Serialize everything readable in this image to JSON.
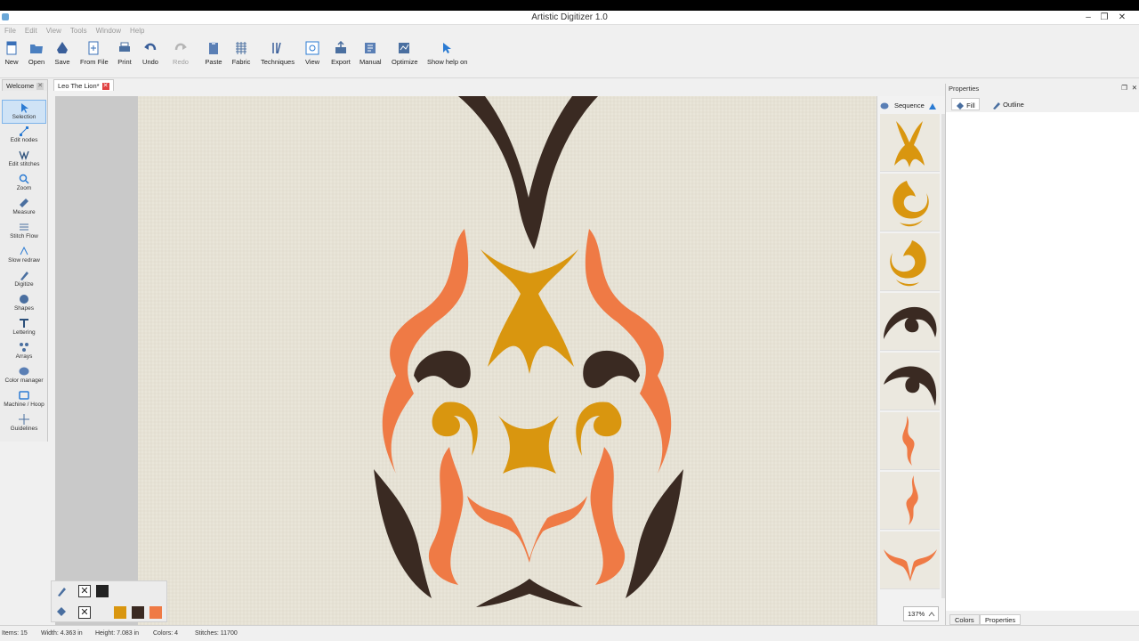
{
  "window": {
    "title": "Artistic Digitizer 1.0",
    "controls": [
      "–",
      "❐",
      "✕"
    ]
  },
  "menu": [
    "File",
    "Edit",
    "View",
    "Tools",
    "Window",
    "Help"
  ],
  "toolbar": [
    {
      "label": "New",
      "icon": "new-file-icon",
      "enabled": true
    },
    {
      "label": "Open",
      "icon": "open-folder-icon",
      "enabled": true
    },
    {
      "label": "Save",
      "icon": "save-icon",
      "enabled": true
    },
    {
      "label": "From File",
      "icon": "from-file-icon",
      "enabled": true
    },
    {
      "label": "Print",
      "icon": "print-icon",
      "enabled": true
    },
    {
      "label": "Undo",
      "icon": "undo-icon",
      "enabled": true
    },
    {
      "label": "Redo",
      "icon": "redo-icon",
      "enabled": false
    },
    {
      "label": "Paste",
      "icon": "paste-icon",
      "enabled": true
    },
    {
      "label": "Fabric",
      "icon": "fabric-icon",
      "enabled": true
    },
    {
      "label": "Techniques",
      "icon": "techniques-icon",
      "enabled": true
    },
    {
      "label": "View",
      "icon": "view-icon",
      "enabled": true
    },
    {
      "label": "Export",
      "icon": "export-icon",
      "enabled": true
    },
    {
      "label": "Manual",
      "icon": "manual-icon",
      "enabled": true
    },
    {
      "label": "Optimize",
      "icon": "optimize-icon",
      "enabled": true
    },
    {
      "label": "Show help on",
      "icon": "help-icon",
      "enabled": true
    }
  ],
  "tabs": [
    {
      "label": "Welcome",
      "active": false
    },
    {
      "label": "Leo The Lion*",
      "active": true
    }
  ],
  "tools": [
    {
      "label": "Selection",
      "icon": "selection-arrow-icon",
      "selected": true
    },
    {
      "label": "Edit nodes",
      "icon": "edit-nodes-icon",
      "selected": false
    },
    {
      "label": "Edit stitches",
      "icon": "edit-stitches-icon",
      "selected": false
    },
    {
      "label": "Zoom",
      "icon": "zoom-icon",
      "selected": false
    },
    {
      "label": "Measure",
      "icon": "measure-icon",
      "selected": false
    },
    {
      "label": "Stitch Flow",
      "icon": "stitch-flow-icon",
      "selected": false
    },
    {
      "label": "Slow redraw",
      "icon": "slow-redraw-icon",
      "selected": false
    },
    {
      "label": "Digitize",
      "icon": "digitize-icon",
      "selected": false
    },
    {
      "label": "Shapes",
      "icon": "shapes-icon",
      "selected": false
    },
    {
      "label": "Lettering",
      "icon": "lettering-icon",
      "selected": false
    },
    {
      "label": "Arrays",
      "icon": "arrays-icon",
      "selected": false
    },
    {
      "label": "Color manager",
      "icon": "color-manager-icon",
      "selected": false
    },
    {
      "label": "Machine / Hoop",
      "icon": "machine-hoop-icon",
      "selected": false
    },
    {
      "label": "Guidelines",
      "icon": "guidelines-icon",
      "selected": false
    }
  ],
  "sequence": {
    "label": "Sequence",
    "thumbs": [
      {
        "name": "gold-crest",
        "color": "#d9960f"
      },
      {
        "name": "gold-swirl-left",
        "color": "#d9960f"
      },
      {
        "name": "gold-swirl-right",
        "color": "#d9960f"
      },
      {
        "name": "dark-eye-left",
        "color": "#3a2a22"
      },
      {
        "name": "dark-eye-right",
        "color": "#3a2a22"
      },
      {
        "name": "orange-flame-left",
        "color": "#ef7a45"
      },
      {
        "name": "orange-flame-right",
        "color": "#ef7a45"
      },
      {
        "name": "orange-mouth",
        "color": "#ef7a45"
      }
    ]
  },
  "zoom": "137%",
  "properties": {
    "title": "Properties",
    "tabs": [
      {
        "label": "Fill",
        "icon": "fill-bucket-icon"
      },
      {
        "label": "Outline",
        "icon": "pen-outline-icon"
      }
    ],
    "bottom_tabs": [
      "Colors",
      "Properties"
    ]
  },
  "colors_panel": {
    "swatches": [
      "#d9960f",
      "#3a2a22",
      "#ef7a45"
    ],
    "outline_swatch": "#222222"
  },
  "status": {
    "items": "Items: 15",
    "width": "Width: 4.363 in",
    "height": "Height: 7.083 in",
    "colors": "Colors: 4",
    "stitches": "Stitches: 11700"
  },
  "palette": {
    "dark": "#3a2a22",
    "gold": "#d9960f",
    "orange": "#ef7a45",
    "fabric": "#e9e5d9",
    "accent": "#2b7bd3"
  }
}
